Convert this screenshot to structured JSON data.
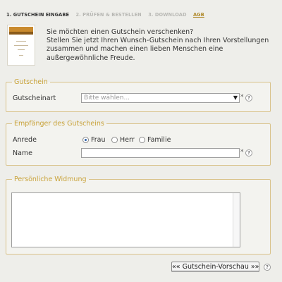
{
  "steps": [
    {
      "label": "1. GUTSCHEIN EINGABE"
    },
    {
      "label": "2. PRÜFEN & BESTELLEN"
    },
    {
      "label": "3. DOWNLOAD"
    },
    {
      "label": "AGB"
    }
  ],
  "intro": {
    "line1": "Sie möchten einen Gutschein verschenken?",
    "line2": "Stellen Sie jetzt Ihren Wunsch-Gutschein nach Ihren Vorstellungen zusammen und machen einen lieben Menschen eine außergewöhnliche Freude."
  },
  "voucher_section": {
    "legend": "Gutschein",
    "type_label": "Gutscheinart",
    "type_placeholder": "Bitte wählen...",
    "required": "*"
  },
  "recipient_section": {
    "legend": "Empfänger des Gutscheins",
    "salutation_label": "Anrede",
    "options": [
      "Frau",
      "Herr",
      "Familie"
    ],
    "selected": "Frau",
    "name_label": "Name",
    "required": "*"
  },
  "dedication_section": {
    "legend": "Persönliche Widmung"
  },
  "help_glyph": "?",
  "preview_button": "«« Gutschein-Vorschau »»"
}
